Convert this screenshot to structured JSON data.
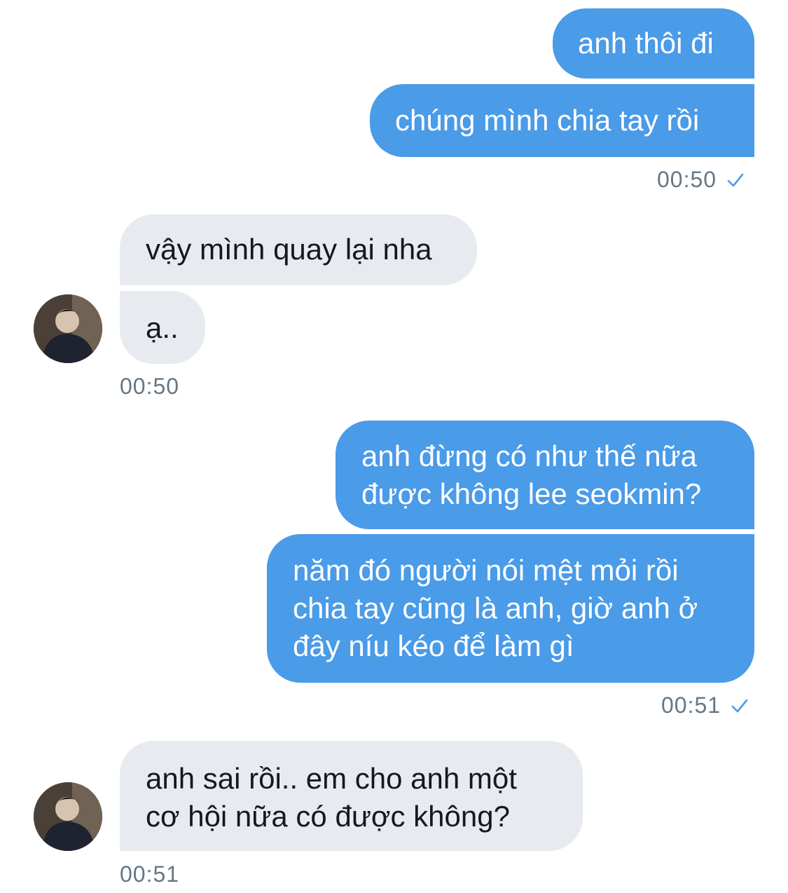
{
  "messages": {
    "m1": "anh thôi đi",
    "m2": "chúng mình chia tay rồi",
    "t1": "00:50",
    "m3": "vậy mình quay lại nha",
    "m4": "ạ..",
    "t2": "00:50",
    "m5": "anh đừng có như thế nữa\nđược không lee seokmin?",
    "m6": "năm đó người nói mệt mỏi rồi\nchia tay cũng là anh, giờ anh ở\nđây níu kéo để làm gì",
    "t3": "00:51",
    "m7": "anh sai rồi.. em cho anh một\ncơ hội nữa có được không?",
    "t4": "00:51"
  },
  "colors": {
    "outgoing_bubble": "#4a9be8",
    "incoming_bubble": "#e7ebf0",
    "timestamp": "#657786",
    "read_check": "#4a9be8"
  },
  "icons": {
    "read_receipt": "checkmark-icon",
    "contact": "avatar"
  }
}
